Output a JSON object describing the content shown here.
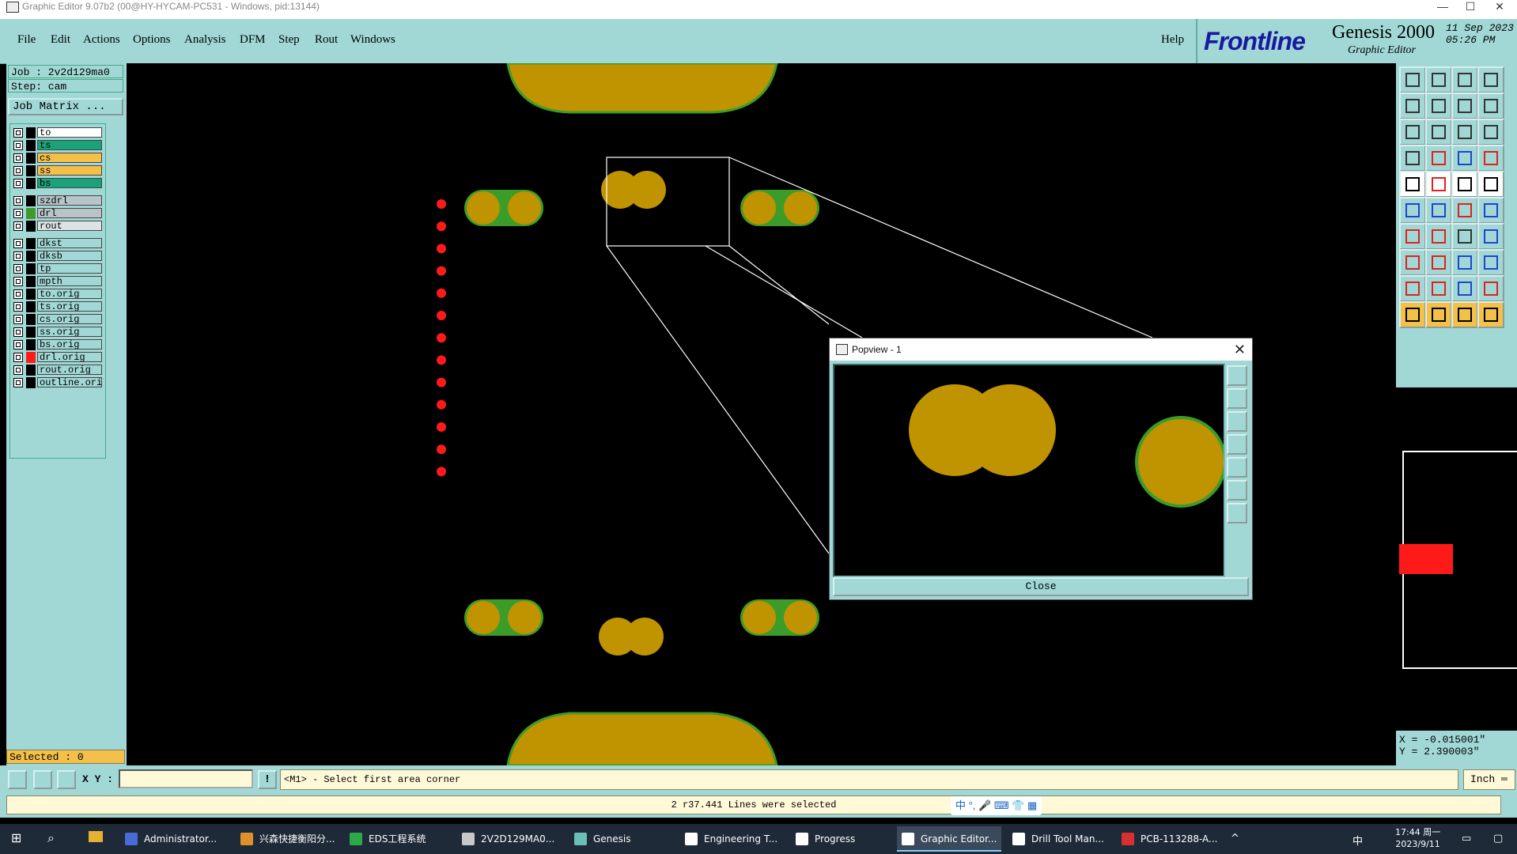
{
  "window": {
    "title": "Graphic Editor 9.07b2 (00@HY-HYCAM-PC531 - Windows, pid:13144)",
    "controls": [
      "—",
      "☐",
      "✕"
    ]
  },
  "menu": {
    "items": [
      "File",
      "Edit",
      "Actions",
      "Options",
      "Analysis",
      "DFM",
      "Step",
      "Rout",
      "Windows"
    ],
    "help": "Help"
  },
  "brand": {
    "logo": "Frontline",
    "product": "Genesis 2000",
    "subtitle": "Graphic Editor",
    "date": "11 Sep 2023",
    "time": "05:26 PM"
  },
  "job": {
    "job_line": "Job : 2v2d129ma0",
    "step_line": "Step: cam",
    "matrix_button": "Job Matrix ..."
  },
  "layers": [
    {
      "name": "to",
      "color": "#ffffff",
      "swatch": "#000000"
    },
    {
      "name": "ts",
      "color": "#1aa37a",
      "swatch": "#000000"
    },
    {
      "name": "cs",
      "color": "#f3c04a",
      "swatch": "#000000"
    },
    {
      "name": "ss",
      "color": "#f3c04a",
      "swatch": "#000000"
    },
    {
      "name": "bs",
      "color": "#1aa37a",
      "swatch": "#000000"
    },
    {
      "name": "szdrl",
      "color": "#b9c4c8",
      "swatch": "#000000"
    },
    {
      "name": "drl",
      "color": "#b9c4c8",
      "swatch": "#3c9c2a"
    },
    {
      "name": "rout",
      "color": "#dde3e5",
      "swatch": "#000000"
    },
    {
      "name": "dkst",
      "color": "#a1d8d6",
      "swatch": "#000000"
    },
    {
      "name": "dksb",
      "color": "#a1d8d6",
      "swatch": "#000000"
    },
    {
      "name": "tp",
      "color": "#a1d8d6",
      "swatch": "#000000"
    },
    {
      "name": "mpth",
      "color": "#a1d8d6",
      "swatch": "#000000"
    },
    {
      "name": "to.orig",
      "color": "#a1d8d6",
      "swatch": "#000000"
    },
    {
      "name": "ts.orig",
      "color": "#a1d8d6",
      "swatch": "#000000"
    },
    {
      "name": "cs.orig",
      "color": "#a1d8d6",
      "swatch": "#000000"
    },
    {
      "name": "ss.orig",
      "color": "#a1d8d6",
      "swatch": "#000000"
    },
    {
      "name": "bs.orig",
      "color": "#a1d8d6",
      "swatch": "#000000"
    },
    {
      "name": "drl.orig",
      "color": "#a1d8d6",
      "swatch": "#ff1a1a"
    },
    {
      "name": "rout.orig",
      "color": "#a1d8d6",
      "swatch": "#000000"
    },
    {
      "name": "outline.orig",
      "color": "#a1d8d6",
      "swatch": "#000000"
    }
  ],
  "selected": "Selected : 0",
  "coords": {
    "x": "X = -0.015001\"",
    "y": "Y = 2.390003\""
  },
  "command": {
    "xy_label": "X Y :",
    "xy_value": "",
    "bang": "!",
    "prompt": "<M1> - Select first area corner",
    "unit": "Inch ═"
  },
  "status": {
    "message": "2 r37.441 Lines were selected",
    "ime": "中 °, 🎤 ⌨ 👕 ▦"
  },
  "popview": {
    "title": "Popview - 1",
    "close_x": "✕",
    "close_button": "Close"
  },
  "taskbar": {
    "items": [
      {
        "label": "Administrator...",
        "color": "#4a6ad8"
      },
      {
        "label": "兴森快捷衡阳分...",
        "color": "#e0902a"
      },
      {
        "label": "EDS工程系统",
        "color": "#2aa84a"
      },
      {
        "label": "2V2D129MA0...",
        "color": "#c8c8c8"
      },
      {
        "label": "Genesis",
        "color": "#6ac0b8"
      },
      {
        "label": "Engineering T...",
        "color": "#ffffff"
      },
      {
        "label": "Progress",
        "color": "#ffffff"
      },
      {
        "label": "Graphic Editor...",
        "color": "#ffffff"
      },
      {
        "label": "Drill Tool Man...",
        "color": "#ffffff"
      },
      {
        "label": "PCB-113288-A...",
        "color": "#d83030"
      }
    ],
    "time": "17:44 周一",
    "date": "2023/9/11",
    "lang": "中"
  },
  "colors": {
    "panel": "#a1d8d6",
    "pad": "#c09300",
    "pad_outline": "#3c9c2a",
    "drill": "#ff1a1a",
    "prompt_bg": "#fff9d8"
  }
}
